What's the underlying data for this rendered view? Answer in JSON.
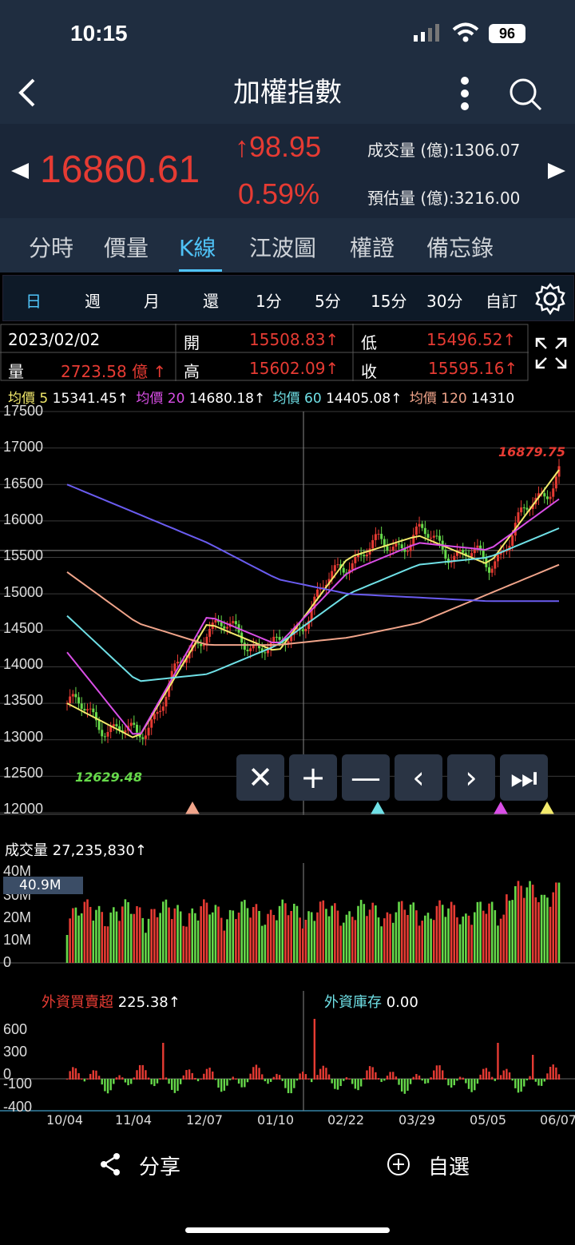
{
  "status": {
    "time": "10:15",
    "battery": "96"
  },
  "header": {
    "title": "加權指數"
  },
  "quote": {
    "price": "16860.61",
    "change": "98.95",
    "change_pct": "0.59%",
    "volume_label": "成交量 (億):1306.07",
    "est_label": "預估量 (億):3216.00"
  },
  "tabs": [
    "分時",
    "價量",
    "K線",
    "江波圖",
    "權證",
    "備忘錄"
  ],
  "periods": [
    "日",
    "週",
    "月",
    "還",
    "1分",
    "5分",
    "15分",
    "30分",
    "自訂"
  ],
  "info": {
    "date": "2023/02/02",
    "open_label": "開",
    "open": "15508.83↑",
    "low_label": "低",
    "low": "15496.52↑",
    "vol_label": "量",
    "vol": "2723.58 億 ↑",
    "high_label": "高",
    "high": "15602.09↑",
    "close_label": "收",
    "close": "15595.16↑"
  },
  "ma": {
    "ma5": "均價 5",
    "ma5v": "15341.45↑",
    "ma20": "均價 20",
    "ma20v": "14680.18↑",
    "ma60": "均價 60",
    "ma60v": "14405.08↑",
    "ma120": "均價 120",
    "ma120v": "14310"
  },
  "kline": {
    "hi": "16879.75",
    "lo": "12629.48"
  },
  "volume": {
    "label": "成交量",
    "value": "27,235,830↑",
    "badge": "40.9M"
  },
  "foreign": {
    "label": "外資買賣超",
    "value": "225.38↑",
    "inv_label": "外資庫存",
    "inv_value": "0.00"
  },
  "yaxis": [
    "17500",
    "17000",
    "16500",
    "16000",
    "15500",
    "15000",
    "14500",
    "14000",
    "13500",
    "13000",
    "12500",
    "12000"
  ],
  "vol_axis": [
    "40M",
    "30M",
    "20M",
    "10M",
    "0"
  ],
  "f_axis": [
    "600",
    "300",
    "0",
    "-100",
    "-400"
  ],
  "xaxis": [
    "10/04",
    "11/04",
    "12/07",
    "01/10",
    "02/22",
    "03/29",
    "05/05",
    "06/07"
  ],
  "bottom": {
    "share": "分享",
    "watch": "自選"
  },
  "colors": {
    "up": "#e63b33",
    "down": "#66d94a",
    "ma5": "#f2e96b",
    "ma20": "#d94ee6",
    "ma60": "#6fe0e6",
    "ma120": "#f0a48a",
    "ma240": "#6a5cf0"
  },
  "chart_data": {
    "type": "line",
    "x": [
      "10/04",
      "11/04",
      "12/07",
      "01/10",
      "02/22",
      "03/29",
      "05/05",
      "06/07"
    ],
    "series": [
      {
        "name": "均價 5",
        "values": [
          13500,
          13000,
          14600,
          14200,
          15500,
          15800,
          15400,
          16700
        ]
      },
      {
        "name": "均價 20",
        "values": [
          14200,
          13000,
          14700,
          14300,
          15300,
          15700,
          15600,
          16300
        ]
      }
    ],
    "ylim": [
      12000,
      17500
    ]
  }
}
